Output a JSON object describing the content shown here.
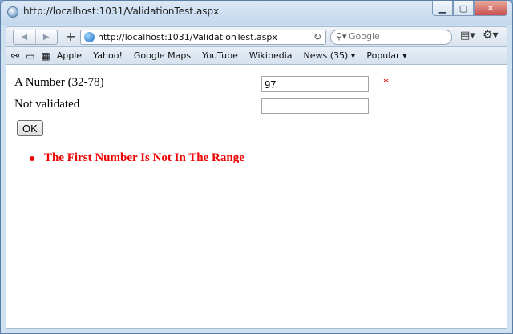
{
  "window": {
    "title": "http://localhost:1031/ValidationTest.aspx"
  },
  "toolbar": {
    "url": "http://localhost:1031/ValidationTest.aspx",
    "search_placeholder": "Google"
  },
  "bookmarks": {
    "items": [
      "Apple",
      "Yahoo!",
      "Google Maps",
      "YouTube",
      "Wikipedia",
      "News (35) ▾",
      "Popular ▾"
    ]
  },
  "form": {
    "field1_label": "A Number (32-78)",
    "field1_value": "97",
    "field1_error_marker": "*",
    "field2_label": "Not validated",
    "field2_value": "",
    "ok_label": "OK"
  },
  "validation": {
    "messages": [
      "The First Number Is Not In The Range"
    ],
    "color": "#ee0000"
  },
  "icons": {
    "app": "safari-globe-icon",
    "back": "back-arrow-icon",
    "forward": "forward-arrow-icon",
    "add": "plus-icon",
    "reload": "reload-icon",
    "search": "search-icon",
    "page": "page-menu-icon",
    "settings": "gear-icon",
    "reading": "glasses-icon",
    "bookmarks": "book-icon",
    "topsites": "grid-icon"
  }
}
